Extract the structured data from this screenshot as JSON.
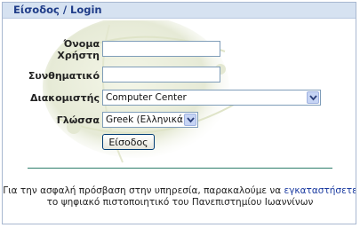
{
  "header": {
    "title": "Είσοδος / Login"
  },
  "form": {
    "username_label_line1": "Όνομα",
    "username_label_line2": "Χρήστη",
    "username_value": "",
    "password_label": "Συνθηματικό",
    "password_value": "",
    "server_label": "Διακομιστής",
    "server_selected": "Computer Center",
    "language_label": "Γλώσσα",
    "language_selected": "Greek (Ελληνικά)",
    "submit_label": "Είσοδος"
  },
  "notice": {
    "line1_prefix": "Για την ασφαλή πρόσβαση στην υπηρεσία, παρακαλούμε να ",
    "link_text": "εγκαταστήσετε",
    "line2": "το ψηφιακό πιστοποιητικό του Πανεπιστημίου Ιωαννίνων"
  },
  "colors": {
    "header_bg": "#d6e2f1",
    "header_text": "#1f3c88",
    "link": "#1a3aa0",
    "divider": "#2e7d6a"
  }
}
